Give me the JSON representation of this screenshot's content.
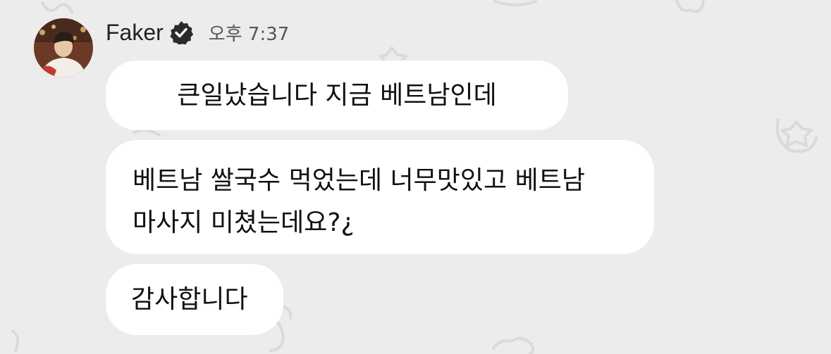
{
  "header": {
    "sender_name": "Faker",
    "timestamp": "오후 7:37"
  },
  "icons": {
    "avatar": "profile-photo",
    "verified": "verified-badge-icon",
    "background": "doodle-pattern"
  },
  "colors": {
    "background": "#ececec",
    "bubble": "#ffffff",
    "text": "#111111",
    "badge": "#2b2b2b"
  },
  "messages": [
    {
      "lines": [
        "큰일났습니다 지금 베트남인데"
      ]
    },
    {
      "lines": [
        "베트남 쌀국수 먹었는데 너무맛있고 베트남",
        "마사지 미쳤는데요?¿"
      ]
    },
    {
      "lines": [
        "감사합니다"
      ]
    }
  ]
}
